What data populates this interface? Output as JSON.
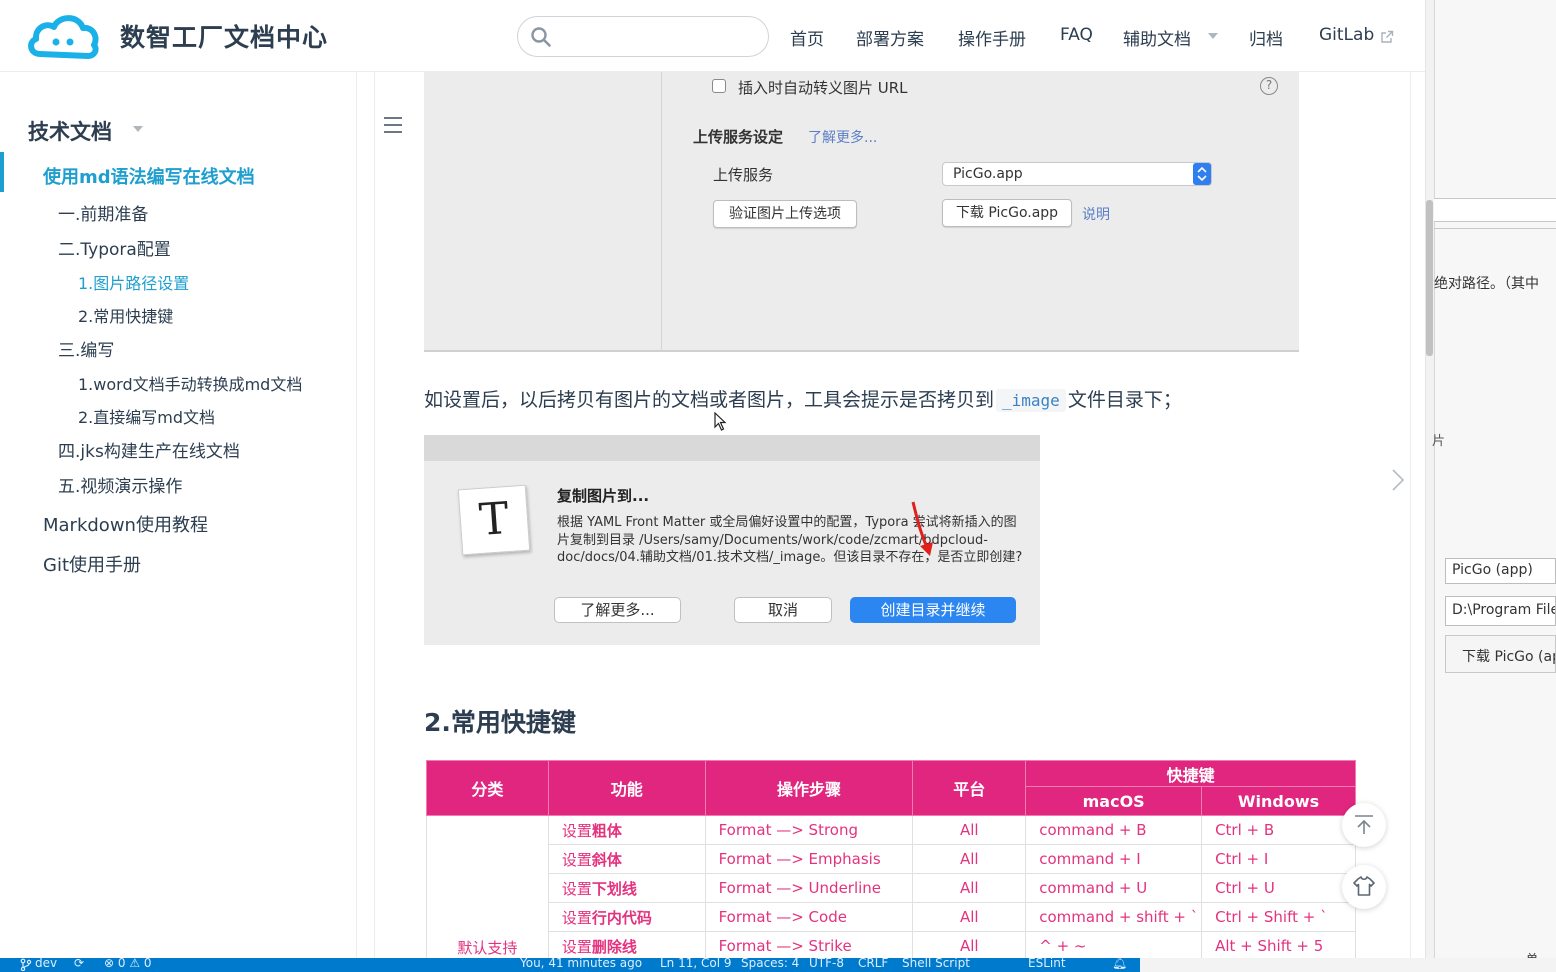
{
  "header": {
    "site_title": "数智工厂文档中心",
    "search_placeholder": "",
    "nav": [
      "首页",
      "部署方案",
      "操作手册",
      "FAQ",
      "辅助文档",
      "归档",
      "GitLab"
    ]
  },
  "sidebar": {
    "section_title": "技术文档",
    "active_item": "使用md语法编写在线文档",
    "items": [
      {
        "label": "一.前期准备"
      },
      {
        "label": "二.Typora配置"
      },
      {
        "label": "1.图片路径设置"
      },
      {
        "label": "2.常用快捷键"
      },
      {
        "label": "三.编写"
      },
      {
        "label": "1.word文档手动转换成md文档"
      },
      {
        "label": "2.直接编写md文档"
      },
      {
        "label": "四.jks构建生产在线文档"
      },
      {
        "label": "五.视频演示操作"
      }
    ],
    "top_items": [
      "Markdown使用教程",
      "Git使用手册"
    ]
  },
  "shot1": {
    "checkbox_label": "插入时自动转义图片 URL",
    "help": "?",
    "section_label": "上传服务设定",
    "learn_more": "了解更多...",
    "service_label": "上传服务",
    "service_value": "PicGo.app",
    "verify_button": "验证图片上传选项",
    "download_button": "下载 PicGo.app",
    "explain_link": "说明"
  },
  "paragraph": {
    "before": "如设置后，以后拷贝有图片的文档或者图片，工具会提示是否拷贝到",
    "code": "_image",
    "after": "文件目录下；"
  },
  "shot2": {
    "icon_letter": "T",
    "title": "复制图片到...",
    "body": "根据 YAML Front Matter 或全局偏好设置中的配置，Typora 尝试将新插入的图片复制到目录 /Users/samy/Documents/work/code/zcmart/bdpcloud-doc/docs/04.辅助文档/01.技术文档/_image。但该目录不存在，是否立即创建?",
    "btn_learn": "了解更多...",
    "btn_cancel": "取消",
    "btn_create": "创建目录并继续"
  },
  "heading": "2.常用快捷键",
  "table": {
    "headers": {
      "category": "分类",
      "function": "功能",
      "steps": "操作步骤",
      "platform": "平台",
      "shortcut": "快捷键",
      "mac": "macOS",
      "win": "Windows"
    },
    "category_value": "默认支持",
    "rows": [
      {
        "prefix": "设置",
        "strong": "粗体",
        "steps": "Format —> Strong",
        "platform": "All",
        "mac": "command + B",
        "win": "Ctrl + B"
      },
      {
        "prefix": "设置",
        "strong": "斜体",
        "steps": "Format —> Emphasis",
        "platform": "All",
        "mac": "command + I",
        "win": "Ctrl + I"
      },
      {
        "prefix": "设置",
        "strong": "下划线",
        "steps": "Format —> Underline",
        "platform": "All",
        "mac": "command + U",
        "win": "Ctrl + U"
      },
      {
        "prefix": "设置",
        "strong": "行内代码",
        "steps": "Format —> Code",
        "platform": "All",
        "mac": "command + shift + `",
        "win": "Ctrl + Shift + `"
      },
      {
        "prefix": "设置",
        "strong": "删除线",
        "steps": "Format —> Strike",
        "platform": "All",
        "mac": "^ + ~",
        "win": "Alt + Shift + 5"
      }
    ]
  },
  "right_pane": {
    "text1": "绝对路径。（其中",
    "text_small": "片",
    "box1": "PicGo (app)",
    "box2": "D:\\Program Files",
    "button": "下载 PicGo (app)",
    "bottom": "单"
  },
  "statusbar": {
    "branch": "dev",
    "problems": "⊗ 0 ⚠ 0",
    "blame": "You, 41 minutes ago",
    "position": "Ln 11, Col 9",
    "spaces": "Spaces: 4",
    "encoding": "UTF-8",
    "eol": "CRLF",
    "language": "Shell Script",
    "eslint": "ESLint"
  },
  "colors": {
    "accent": "#1e9fcf",
    "table_header": "#e0267f",
    "table_text": "#e4327f",
    "status": "#007acc"
  }
}
